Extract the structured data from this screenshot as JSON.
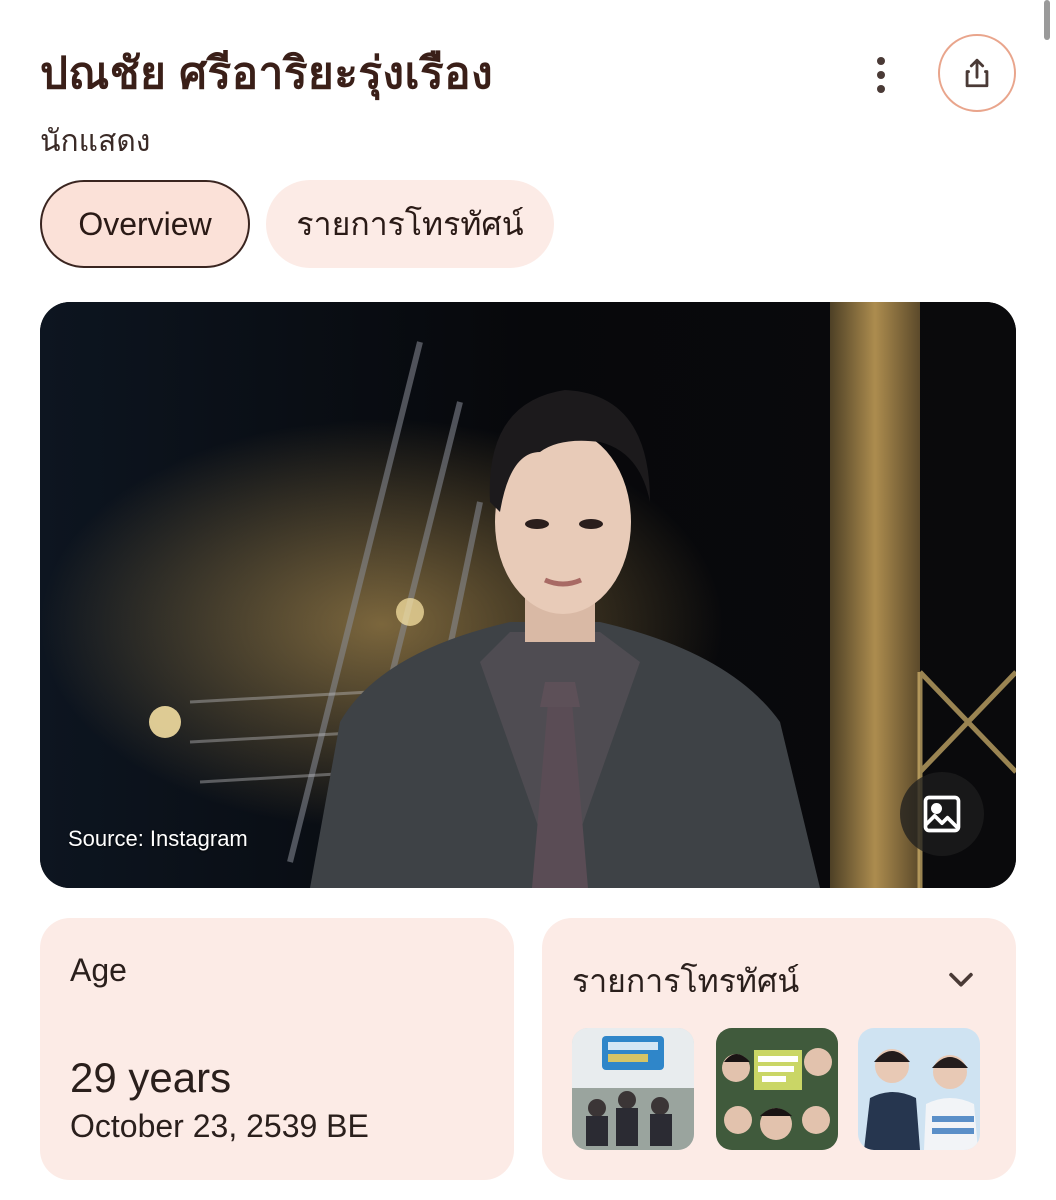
{
  "header": {
    "title": "ปณชัย ศรีอาริยะรุ่งเรือง",
    "subtitle": "นักแสดง",
    "more_icon": "more-vert-icon",
    "share_icon": "share-icon"
  },
  "tabs": [
    {
      "label": "Overview",
      "active": true
    },
    {
      "label": "รายการโทรทัศน์",
      "active": false
    }
  ],
  "hero": {
    "source_text": "Source: Instagram",
    "gallery_icon": "image-gallery-icon"
  },
  "age_card": {
    "label": "Age",
    "value": "29 years",
    "date": "October 23, 2539 BE"
  },
  "tv_card": {
    "label": "รายการโทรทัศน์",
    "expand_icon": "chevron-down-icon",
    "thumbnails": [
      "tv-show-poster-1",
      "tv-show-poster-2",
      "tv-show-poster-3"
    ]
  },
  "colors": {
    "accent": "#e9a58c",
    "chip_bg": "#fcebe6",
    "chip_active_bg": "#fbe1d8",
    "title": "#3a1f18"
  }
}
